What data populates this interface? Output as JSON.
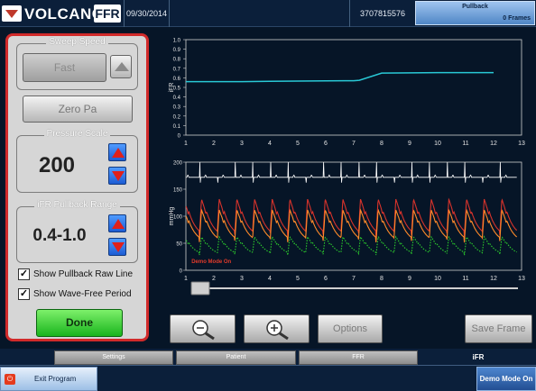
{
  "header": {
    "brand": "VOLCANO",
    "product": "FFR",
    "date": "09/30/2014",
    "patient_id": "3707815576",
    "pullback_label": "Pullback",
    "frames_label": "0 Frames"
  },
  "panel": {
    "sweep_speed": {
      "title": "Sweep Speed",
      "value": "Fast"
    },
    "zero_pa_label": "Zero Pa",
    "pressure_scale": {
      "title": "Pressure Scale",
      "value": "200"
    },
    "ifr_range": {
      "title": "iFR Pullback Range",
      "value": "0.4-1.0"
    },
    "show_pullback_raw_line": {
      "label": "Show Pullback Raw Line",
      "checked": true
    },
    "show_wave_free_period": {
      "label": "Show Wave-Free Period",
      "checked": true
    },
    "done_label": "Done"
  },
  "chart_data": [
    {
      "type": "line",
      "ylabel": "iFR",
      "ylim": [
        0,
        1.0
      ],
      "yticks": [
        "0",
        "0.1",
        "0.2",
        "0.3",
        "0.4",
        "0.5",
        "0.6",
        "0.7",
        "0.8",
        "0.9",
        "1.0"
      ],
      "xticks": [
        "1",
        "2",
        "3",
        "4",
        "5",
        "6",
        "7",
        "8",
        "9",
        "10",
        "11",
        "12",
        "13"
      ],
      "xlim": [
        1,
        13
      ],
      "series": [
        {
          "color": "#29c9d6",
          "x": [
            1,
            2,
            3,
            4,
            5,
            6,
            7,
            7.2,
            8,
            9,
            10,
            11,
            12
          ],
          "y": [
            0.56,
            0.56,
            0.56,
            0.563,
            0.566,
            0.568,
            0.57,
            0.575,
            0.65,
            0.652,
            0.655,
            0.655,
            0.655
          ]
        }
      ]
    },
    {
      "type": "line",
      "ylabel": "mmHg",
      "ylim": [
        0,
        200
      ],
      "yticks": [
        "0",
        "50",
        "100",
        "150",
        "200"
      ],
      "xticks": [
        "1",
        "2",
        "3",
        "4",
        "5",
        "6",
        "7",
        "8",
        "9",
        "10",
        "11",
        "12",
        "13"
      ],
      "xlim": [
        1,
        13
      ],
      "beats_per_unit": 1.5,
      "annotation": "Demo Mode On",
      "series": [
        {
          "color": "#ffffff",
          "kind": "ecg",
          "baseline": 172,
          "peak": 200
        },
        {
          "color": "#d8332b",
          "kind": "pressure",
          "min": 58,
          "max": 132
        },
        {
          "color": "#ff8a2a",
          "kind": "pressure",
          "min": 48,
          "max": 112
        },
        {
          "color": "#2ccf2c",
          "kind": "dotted",
          "min": 26,
          "max": 62
        }
      ]
    }
  ],
  "slider": {
    "value": 0.0
  },
  "toolbar": {
    "zoom_out": "zoom-out",
    "zoom_in": "zoom-in",
    "options_label": "Options",
    "save_frame_label": "Save Frame"
  },
  "tabs": [
    "Settings",
    "Patient",
    "FFR",
    "iFR"
  ],
  "active_tab": "iFR",
  "status": {
    "exit_label": "Exit Program",
    "demo_label": "Demo Mode On"
  }
}
